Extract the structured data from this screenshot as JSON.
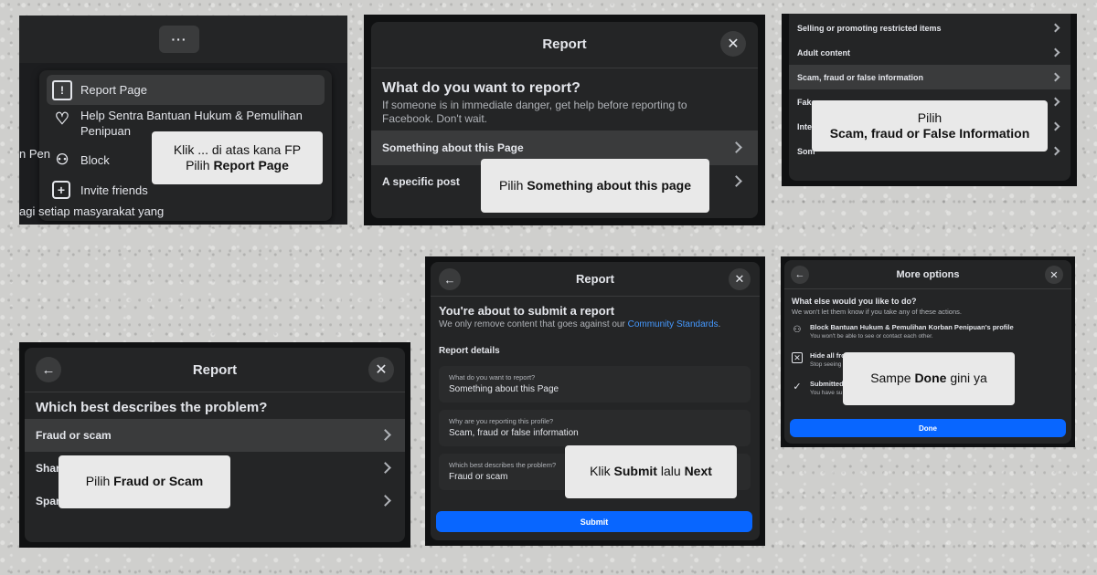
{
  "panel1": {
    "more_button": "···",
    "menu": [
      {
        "label": "Report Page",
        "icon": "report-icon"
      },
      {
        "label": "Help Sentra Bantuan Hukum & Pemulihan Penipuan",
        "icon": "heart-hand-icon"
      },
      {
        "label": "Block",
        "icon": "block-user-icon"
      },
      {
        "label": "Invite friends",
        "icon": "invite-icon"
      }
    ],
    "bg_text": "agi setiap masyarakat yang",
    "bg_text_left": "n Pen",
    "callout_line1": "Klik ... di atas kana FP",
    "callout_pre": "Pilih ",
    "callout_bold": "Report Page"
  },
  "panel2": {
    "title": "Report",
    "heading": "What do you want to report?",
    "subtext": "If someone is in immediate danger, get help before reporting to Facebook. Don't wait.",
    "options": [
      "Something about this Page",
      "A specific post"
    ],
    "callout_pre": "Pilih ",
    "callout_bold": "Something about this page"
  },
  "panel3": {
    "items": [
      "Selling or promoting restricted items",
      "Adult content",
      "Scam, fraud or false information",
      "Fake",
      "Inte",
      "Som"
    ],
    "callout_line1": "Pilih",
    "callout_bold": "Scam, fraud or False Information"
  },
  "panel4": {
    "title": "Report",
    "heading": "Which best describes the problem?",
    "options": [
      "Fraud or scam",
      "Shar",
      "Span"
    ],
    "callout_pre": "Pilih ",
    "callout_bold": "Fraud or Scam"
  },
  "panel5": {
    "title": "Report",
    "heading": "You're about to submit a report",
    "sub_pre": "We only remove content that goes against our ",
    "sub_link": "Community Standards",
    "sub_post": ".",
    "details_label": "Report details",
    "details": [
      {
        "q": "What do you want to report?",
        "a": "Something about this Page"
      },
      {
        "q": "Why are you reporting this profile?",
        "a": "Scam, fraud or false information"
      },
      {
        "q": "Which best describes the problem?",
        "a": "Fraud or scam"
      }
    ],
    "submit": "Submit",
    "callout_pre": "Klik ",
    "callout_bold1": "Submit",
    "callout_mid": " lalu ",
    "callout_bold2": "Next"
  },
  "panel6": {
    "title": "More options",
    "heading": "What else would you like to do?",
    "subtext": "We won't let them know if you take any of these actions.",
    "options": [
      {
        "title": "Block Bantuan Hukum & Pemulihan Korban Penipuan's profile",
        "desc": "You won't be able to see or contact each other."
      },
      {
        "title": "Hide all fro",
        "desc": "Stop seeing"
      },
      {
        "title": "Submitted",
        "desc": "You have su"
      }
    ],
    "done": "Done",
    "callout_pre": "Sampe ",
    "callout_bold": "Done",
    "callout_post": " gini ya"
  },
  "colors": {
    "accent": "#0866ff",
    "panel_bg": "#18191a",
    "dialog_bg": "#242526",
    "highlight": "#3a3b3c",
    "callout_bg": "#e9e9e9"
  }
}
